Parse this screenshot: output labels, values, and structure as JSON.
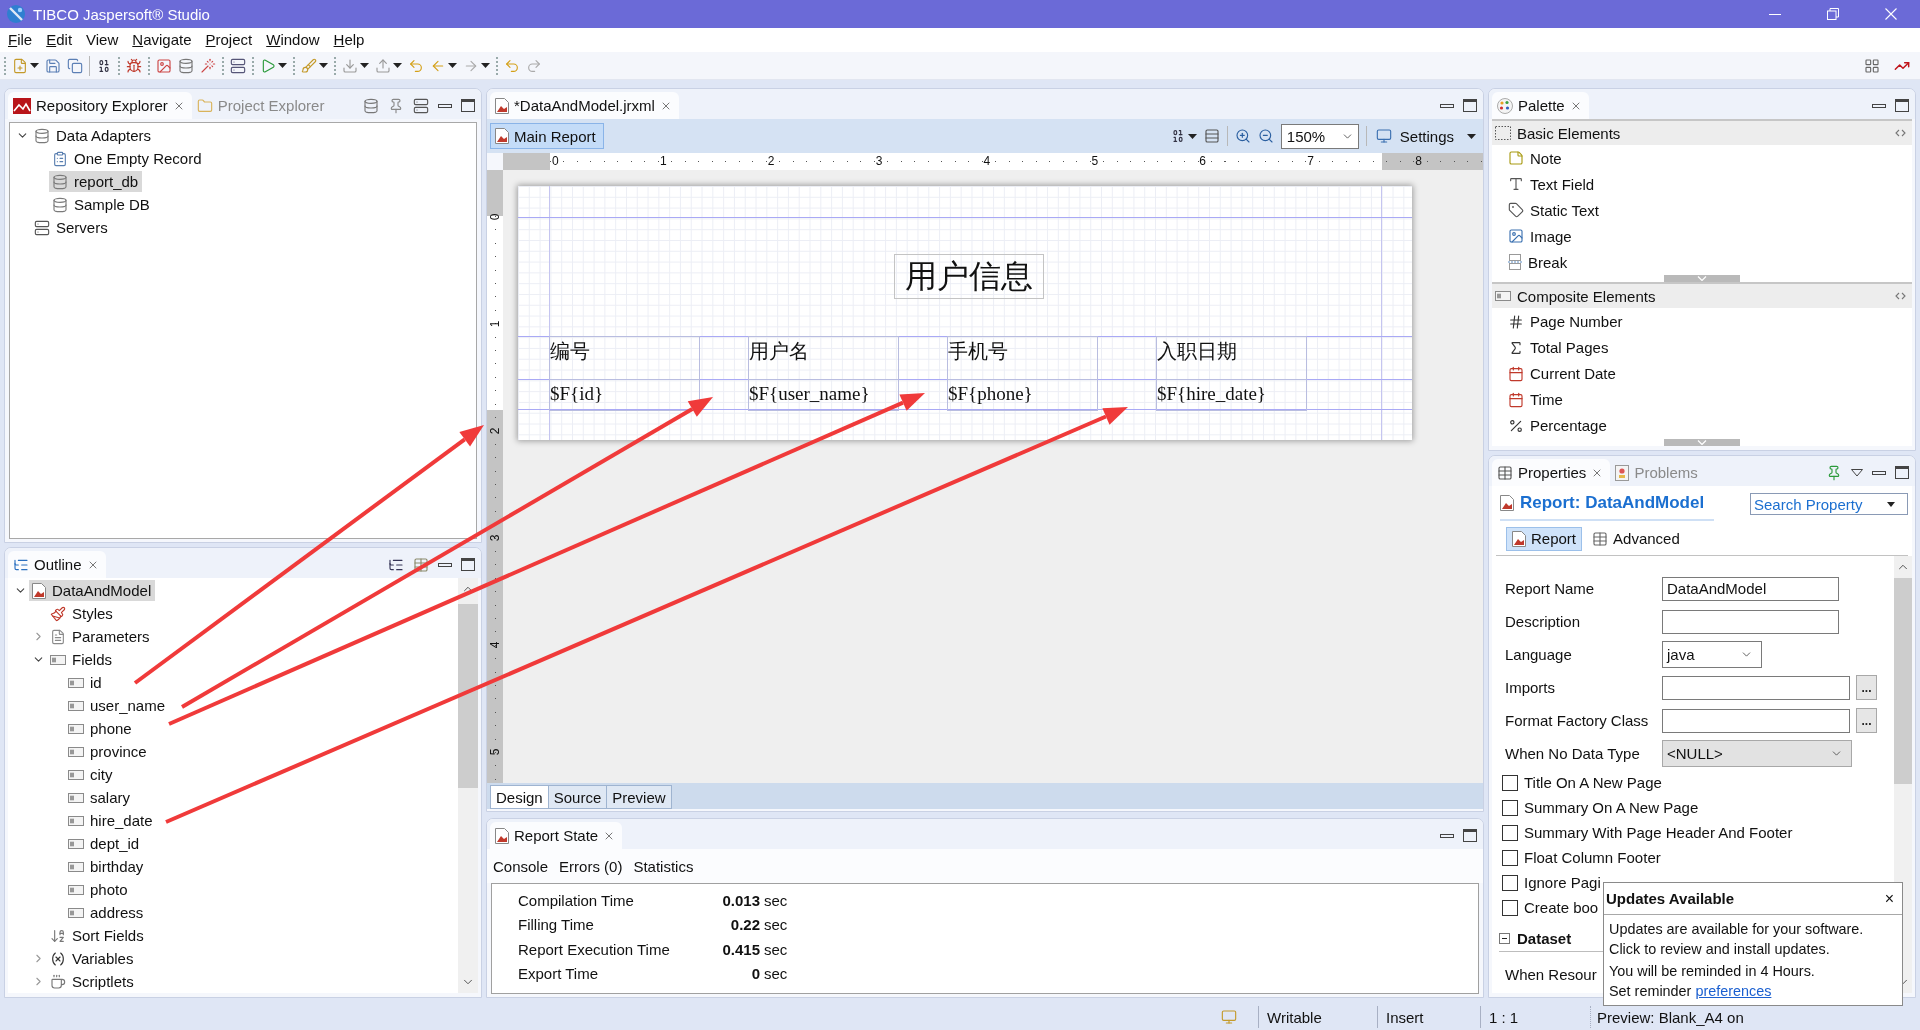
{
  "window": {
    "title": "TIBCO Jaspersoft® Studio"
  },
  "menu": [
    {
      "label": "File",
      "mnemonic": true
    },
    {
      "label": "Edit",
      "mnemonic": true
    },
    {
      "label": "View",
      "mnemonic": false
    },
    {
      "label": "Navigate",
      "mnemonic": true
    },
    {
      "label": "Project",
      "mnemonic": true
    },
    {
      "label": "Window",
      "mnemonic": true
    },
    {
      "label": "Help",
      "mnemonic": true
    }
  ],
  "repository": {
    "tabs": [
      {
        "label": "Repository Explorer",
        "selected": true
      },
      {
        "label": "Project Explorer",
        "selected": false
      }
    ],
    "tree": [
      {
        "label": "Data Adapters",
        "kind": "adapters",
        "expanded": true,
        "selected": false,
        "children": [
          {
            "label": "One Empty Record",
            "kind": "record",
            "selected": false
          },
          {
            "label": "report_db",
            "kind": "database",
            "selected": true
          },
          {
            "label": "Sample DB",
            "kind": "database",
            "selected": false
          }
        ]
      },
      {
        "label": "Servers",
        "kind": "server",
        "selected": false
      }
    ]
  },
  "outline": {
    "tabs": [
      {
        "label": "Outline",
        "selected": true
      }
    ],
    "tree": [
      {
        "label": "DataAndModel",
        "kind": "report",
        "expanded": true,
        "selected": true,
        "children": [
          {
            "label": "Styles",
            "kind": "styles",
            "selected": false
          },
          {
            "label": "Parameters",
            "kind": "parameters",
            "expanded": false,
            "selected": false
          },
          {
            "label": "Fields",
            "kind": "fields",
            "expanded": true,
            "selected": false,
            "children": [
              {
                "label": "id",
                "kind": "field",
                "selected": false
              },
              {
                "label": "user_name",
                "kind": "field",
                "selected": false
              },
              {
                "label": "phone",
                "kind": "field",
                "selected": false
              },
              {
                "label": "province",
                "kind": "field",
                "selected": false
              },
              {
                "label": "city",
                "kind": "field",
                "selected": false
              },
              {
                "label": "salary",
                "kind": "field",
                "selected": false
              },
              {
                "label": "hire_date",
                "kind": "field",
                "selected": false
              },
              {
                "label": "dept_id",
                "kind": "field",
                "selected": false
              },
              {
                "label": "birthday",
                "kind": "field",
                "selected": false
              },
              {
                "label": "photo",
                "kind": "field",
                "selected": false
              },
              {
                "label": "address",
                "kind": "field",
                "selected": false
              }
            ]
          },
          {
            "label": "Sort Fields",
            "kind": "sort",
            "selected": false
          },
          {
            "label": "Variables",
            "kind": "variables",
            "expanded": false,
            "selected": false
          },
          {
            "label": "Scriptlets",
            "kind": "scriptlets",
            "expanded": false,
            "selected": false
          }
        ]
      }
    ]
  },
  "editor": {
    "tabs": [
      {
        "label": "*DataAndModel.jrxml",
        "selected": true
      }
    ],
    "main_report": {
      "label": "Main Report",
      "selected": true
    },
    "zoom": "150%",
    "settings": "Settings",
    "ruler_h": [
      "0",
      "1",
      "2",
      "3",
      "4",
      "5",
      "6",
      "7",
      "8"
    ],
    "ruler_v": [
      "0",
      "1",
      "2",
      "3",
      "4",
      "5"
    ],
    "report": {
      "title": "用户信息",
      "columns": [
        {
          "header": "编号",
          "field": "$F{id}"
        },
        {
          "header": "用户名",
          "field": "$F{user_name}"
        },
        {
          "header": "手机号",
          "field": "$F{phone}"
        },
        {
          "header": "入职日期",
          "field": "$F{hire_date}"
        }
      ]
    },
    "view_tabs": [
      {
        "label": "Design",
        "selected": true
      },
      {
        "label": "Source",
        "selected": false
      },
      {
        "label": "Preview",
        "selected": false
      }
    ]
  },
  "report_state": {
    "tabs": [
      {
        "label": "Report State",
        "selected": true
      }
    ],
    "subtabs": [
      "Console",
      "Errors (0)",
      "Statistics"
    ],
    "stats": [
      {
        "label": "Compilation Time",
        "value": "0.013",
        "unit": "sec"
      },
      {
        "label": "Filling Time",
        "value": "0.22",
        "unit": "sec"
      },
      {
        "label": "Report Execution Time",
        "value": "0.415",
        "unit": "sec"
      },
      {
        "label": "Export Time",
        "value": "0",
        "unit": "sec"
      }
    ]
  },
  "palette": {
    "tabs": [
      {
        "label": "Palette",
        "selected": true
      }
    ],
    "groups": [
      {
        "label": "Basic Elements",
        "kind": "basic",
        "items": [
          {
            "label": "Note",
            "kind": "note"
          },
          {
            "label": "Text Field",
            "kind": "textfield"
          },
          {
            "label": "Static Text",
            "kind": "statictext"
          },
          {
            "label": "Image",
            "kind": "image"
          },
          {
            "label": "Break",
            "kind": "break"
          }
        ]
      },
      {
        "label": "Composite Elements",
        "kind": "composite",
        "items": [
          {
            "label": "Page Number",
            "kind": "pagenumber"
          },
          {
            "label": "Total Pages",
            "kind": "totalpages"
          },
          {
            "label": "Current Date",
            "kind": "date"
          },
          {
            "label": "Time",
            "kind": "date"
          },
          {
            "label": "Percentage",
            "kind": "percentage"
          }
        ]
      }
    ]
  },
  "properties": {
    "tabs": [
      {
        "label": "Properties",
        "selected": true
      },
      {
        "label": "Problems",
        "selected": false
      }
    ],
    "heading": "Report: DataAndModel",
    "search": {
      "placeholder": "Search Property"
    },
    "subtabs": [
      {
        "label": "Report",
        "selected": true
      },
      {
        "label": "Advanced",
        "selected": false
      }
    ],
    "fields": [
      {
        "label": "Report Name",
        "kind": "text",
        "value": "DataAndModel"
      },
      {
        "label": "Description",
        "kind": "text"
      },
      {
        "label": "Language",
        "kind": "dropdown",
        "value": "java"
      },
      {
        "label": "Imports",
        "kind": "browse",
        "button": "..."
      },
      {
        "label": "Format Factory Class",
        "kind": "browse",
        "button": "..."
      },
      {
        "label": "When No Data Type",
        "kind": "combo",
        "value": "<NULL>"
      }
    ],
    "checkboxes": [
      {
        "label": "Title On A New Page",
        "checked": false
      },
      {
        "label": "Summary On A New Page",
        "checked": false
      },
      {
        "label": "Summary With Page Header And Footer",
        "checked": false
      },
      {
        "label": "Float Column Footer",
        "checked": false
      },
      {
        "label": "Ignore Pagi",
        "checked": false
      },
      {
        "label": "Create boo",
        "checked": false
      }
    ],
    "section": {
      "label": "Dataset",
      "expanded": true,
      "rows": [
        "When Resour"
      ]
    }
  },
  "popup": {
    "title": "Updates Available",
    "close": "×",
    "message": [
      "Updates are available for your software.",
      "Click to review and install updates."
    ],
    "reminder": "You will be reminded in 4 Hours.",
    "link_prefix": "Set reminder",
    "link": "preferences"
  },
  "status_bar": {
    "mode": "Writable",
    "insert_mode": "Insert",
    "position": "1 : 1",
    "preview": "Preview: Blank_A4 on"
  }
}
